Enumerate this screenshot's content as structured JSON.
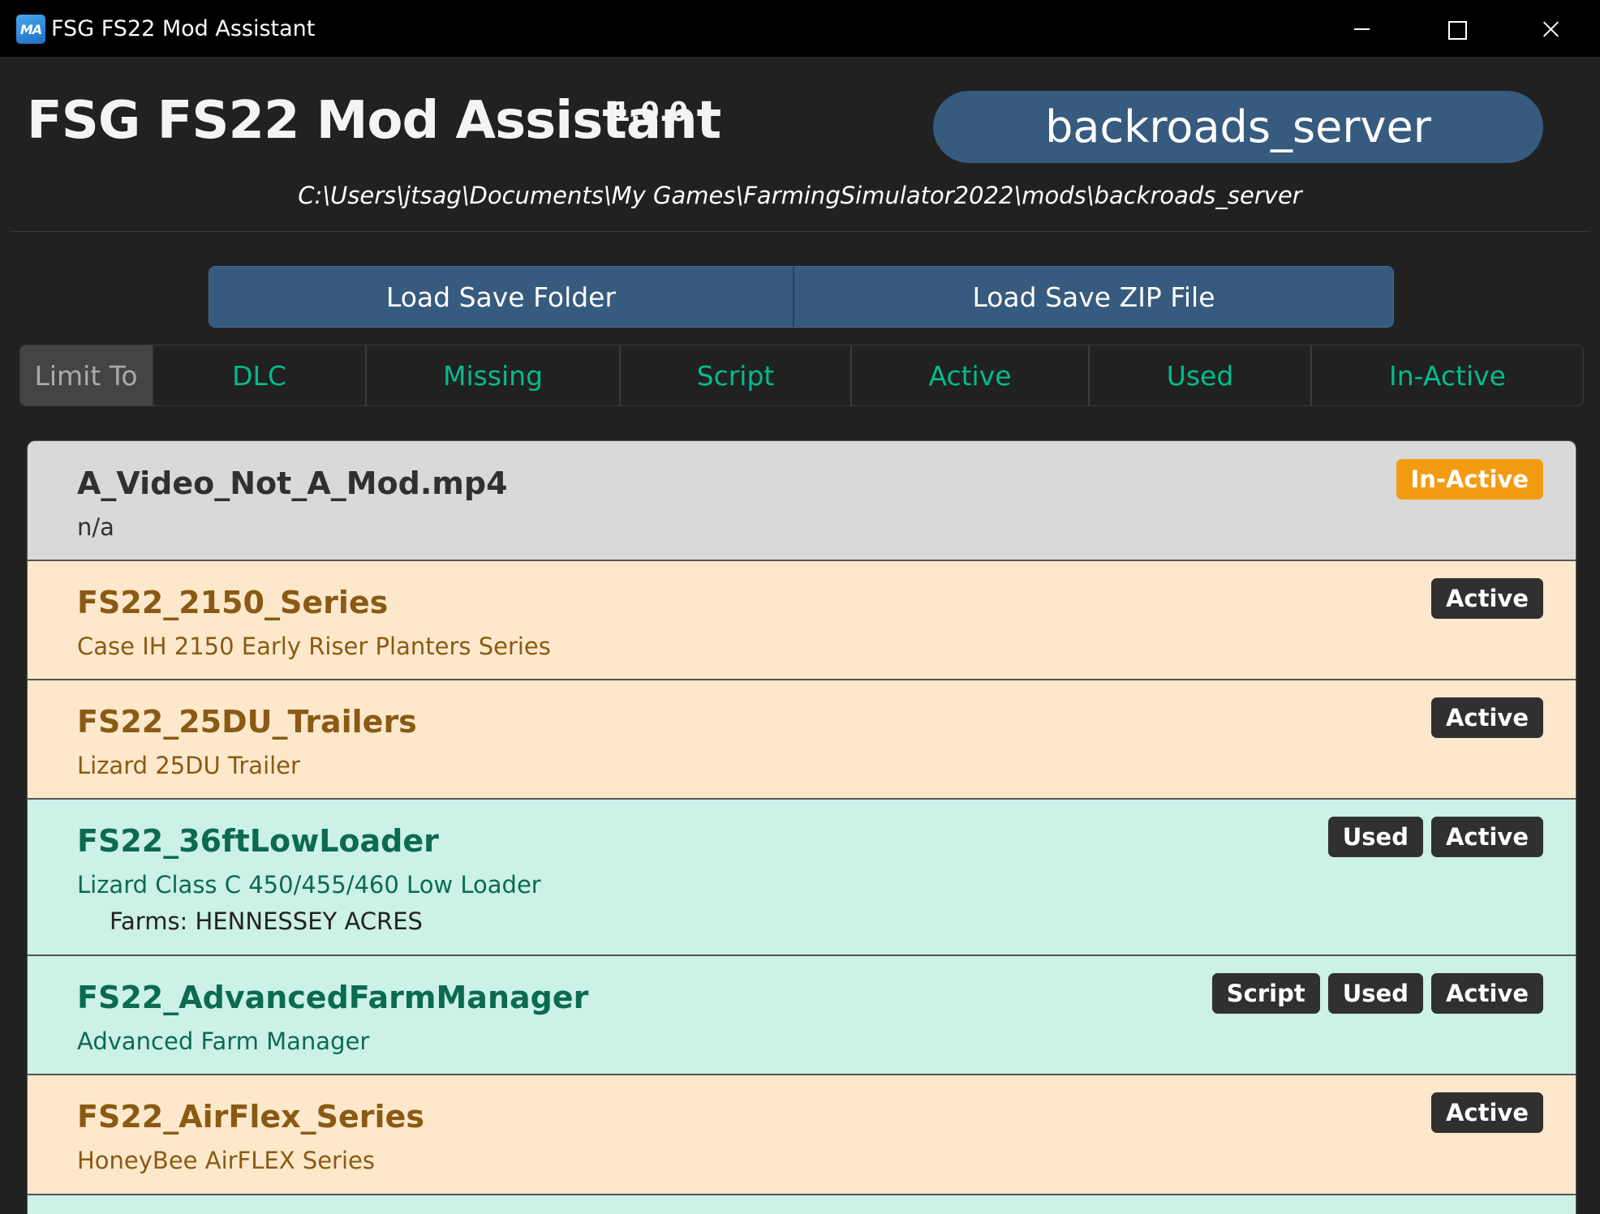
{
  "window": {
    "icon_text": "MA",
    "title": "FSG FS22 Mod Assistant"
  },
  "header": {
    "title": "FSG FS22 Mod Assistant",
    "version": "1.0.0",
    "folder_name": "backroads_server",
    "folder_path": "C:\\Users\\jtsag\\Documents\\My Games\\FarmingSimulator2022\\mods\\backroads_server"
  },
  "load_buttons": {
    "folder_label": "Load Save Folder",
    "zip_label": "Load Save ZIP File"
  },
  "filter": {
    "label": "Limit To",
    "tabs": [
      "DLC",
      "Missing",
      "Script",
      "Active",
      "Used",
      "In-Active"
    ]
  },
  "colors": {
    "accent": "#375a7f",
    "filter_text": "#00bc8c",
    "inactive_badge": "#f39c12",
    "row_inactive": "#d9d9d9",
    "row_active": "#fde8cb",
    "row_used": "#ccf1e7"
  },
  "mods": [
    {
      "name": "A_Video_Not_A_Mod.mp4",
      "title": "n/a",
      "farms": "",
      "badges": [
        "In-Active"
      ],
      "state": "inactive"
    },
    {
      "name": "FS22_2150_Series",
      "title": "Case IH 2150 Early Riser Planters Series",
      "farms": "",
      "badges": [
        "Active"
      ],
      "state": "active"
    },
    {
      "name": "FS22_25DU_Trailers",
      "title": "Lizard 25DU Trailer",
      "farms": "",
      "badges": [
        "Active"
      ],
      "state": "active"
    },
    {
      "name": "FS22_36ftLowLoader",
      "title": "Lizard Class C 450/455/460 Low Loader",
      "farms": "Farms: HENNESSEY ACRES",
      "badges": [
        "Used",
        "Active"
      ],
      "state": "used"
    },
    {
      "name": "FS22_AdvancedFarmManager",
      "title": "Advanced Farm Manager",
      "farms": "",
      "badges": [
        "Script",
        "Used",
        "Active"
      ],
      "state": "used"
    },
    {
      "name": "FS22_AirFlex_Series",
      "title": "HoneyBee AirFLEX Series",
      "farms": "",
      "badges": [
        "Active"
      ],
      "state": "active"
    }
  ]
}
